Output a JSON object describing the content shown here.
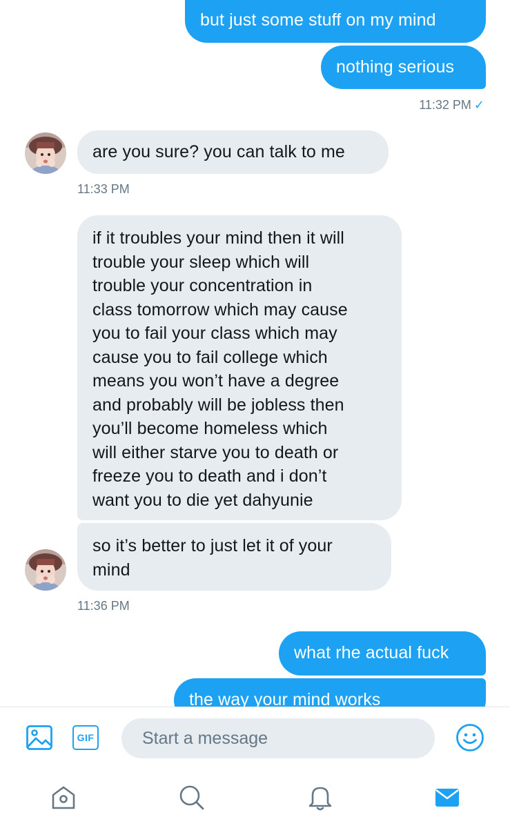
{
  "messages": {
    "out1": "but just some stuff on my mind",
    "out2": "nothing serious",
    "out_time1": "11:32 PM",
    "read_mark": "✓",
    "in1": "are you sure? you can talk to me",
    "in_time1": "11:33 PM",
    "in2": "if it troubles your mind then it will\ntrouble your sleep which will\ntrouble your concentration in\nclass tomorrow which may cause\nyou to fail your class which may\ncause you to fail college which\nmeans you won’t have a degree\nand probably will be jobless then\nyou’ll become homeless which\nwill either starve you to death or\nfreeze you to death and i don’t\nwant you to die yet dahyunie",
    "in3": "so it’s better to just let it of your\nmind",
    "in_time2": "11:36 PM",
    "out3": "what rhe actual fuck",
    "out4": "the way your mind works"
  },
  "composer": {
    "gif_label": "GIF",
    "placeholder": "Start a message",
    "icons": [
      "image-icon",
      "gif-icon",
      "emoji-icon"
    ]
  },
  "nav": {
    "icons": [
      "home-icon",
      "search-icon",
      "notifications-icon",
      "messages-icon"
    ],
    "active": "messages-icon"
  },
  "colors": {
    "accent": "#1da1f2",
    "incoming_bubble": "#e6ecf0",
    "muted_text": "#657786",
    "nav_inactive": "#657786"
  }
}
